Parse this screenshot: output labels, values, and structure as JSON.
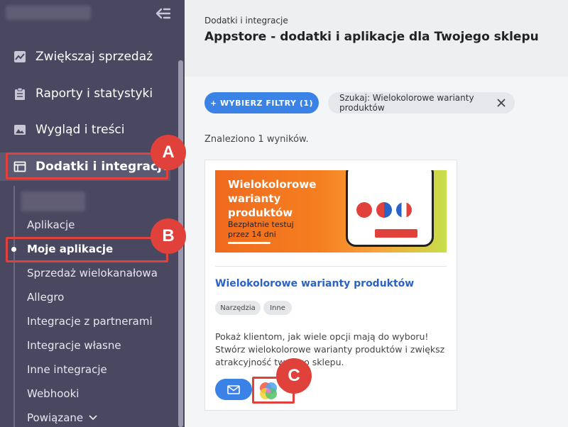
{
  "sidebar": {
    "nav": [
      {
        "label": "Zwiększaj sprzedaż",
        "icon": "chart-line-icon"
      },
      {
        "label": "Raporty i statystyki",
        "icon": "clipboard-icon"
      },
      {
        "label": "Wygląd i treści",
        "icon": "image-icon"
      },
      {
        "label": "Dodatki i integracje",
        "icon": "browser-window-icon",
        "active": true
      }
    ],
    "sub": [
      {
        "label": "Aplikacje"
      },
      {
        "label": "Moje aplikacje",
        "active": true
      },
      {
        "label": "Sprzedaż wielokanałowa"
      },
      {
        "label": "Allegro"
      },
      {
        "label": "Integracje z partnerami"
      },
      {
        "label": "Integracje własne"
      },
      {
        "label": "Inne integracje"
      },
      {
        "label": "Webhooki"
      },
      {
        "label": "Powiązane"
      }
    ]
  },
  "header": {
    "breadcrumb": "Dodatki i integracje",
    "title": "Appstore - dodatki i aplikacje dla Twojego sklepu"
  },
  "filters": {
    "button_label": "+ WYBIERZ FILTRY (1)",
    "search_chip": "Szukaj: Wielokolorowe warianty produktów"
  },
  "results_text": "Znaleziono 1 wyników.",
  "card": {
    "banner": {
      "title": "Wielokolorowe warianty produktów",
      "subtitle": "Bezpłatnie testuj przez 14 dni"
    },
    "name": "Wielokolorowe warianty produktów",
    "tags": [
      "Narzędzia",
      "Inne"
    ],
    "description": "Pokaż klientom, jak wiele opcji mają do wyboru! Stwórz wielokolorowe warianty produktów i zwiększ atrakcyjność twojego sklepu."
  },
  "annotations": [
    "A",
    "B",
    "C"
  ],
  "colors": {
    "sidebar_bg": "#4a4761",
    "accent_blue": "#3b82e6",
    "annotation_red": "#e0413b",
    "link_blue": "#2a63c6"
  }
}
